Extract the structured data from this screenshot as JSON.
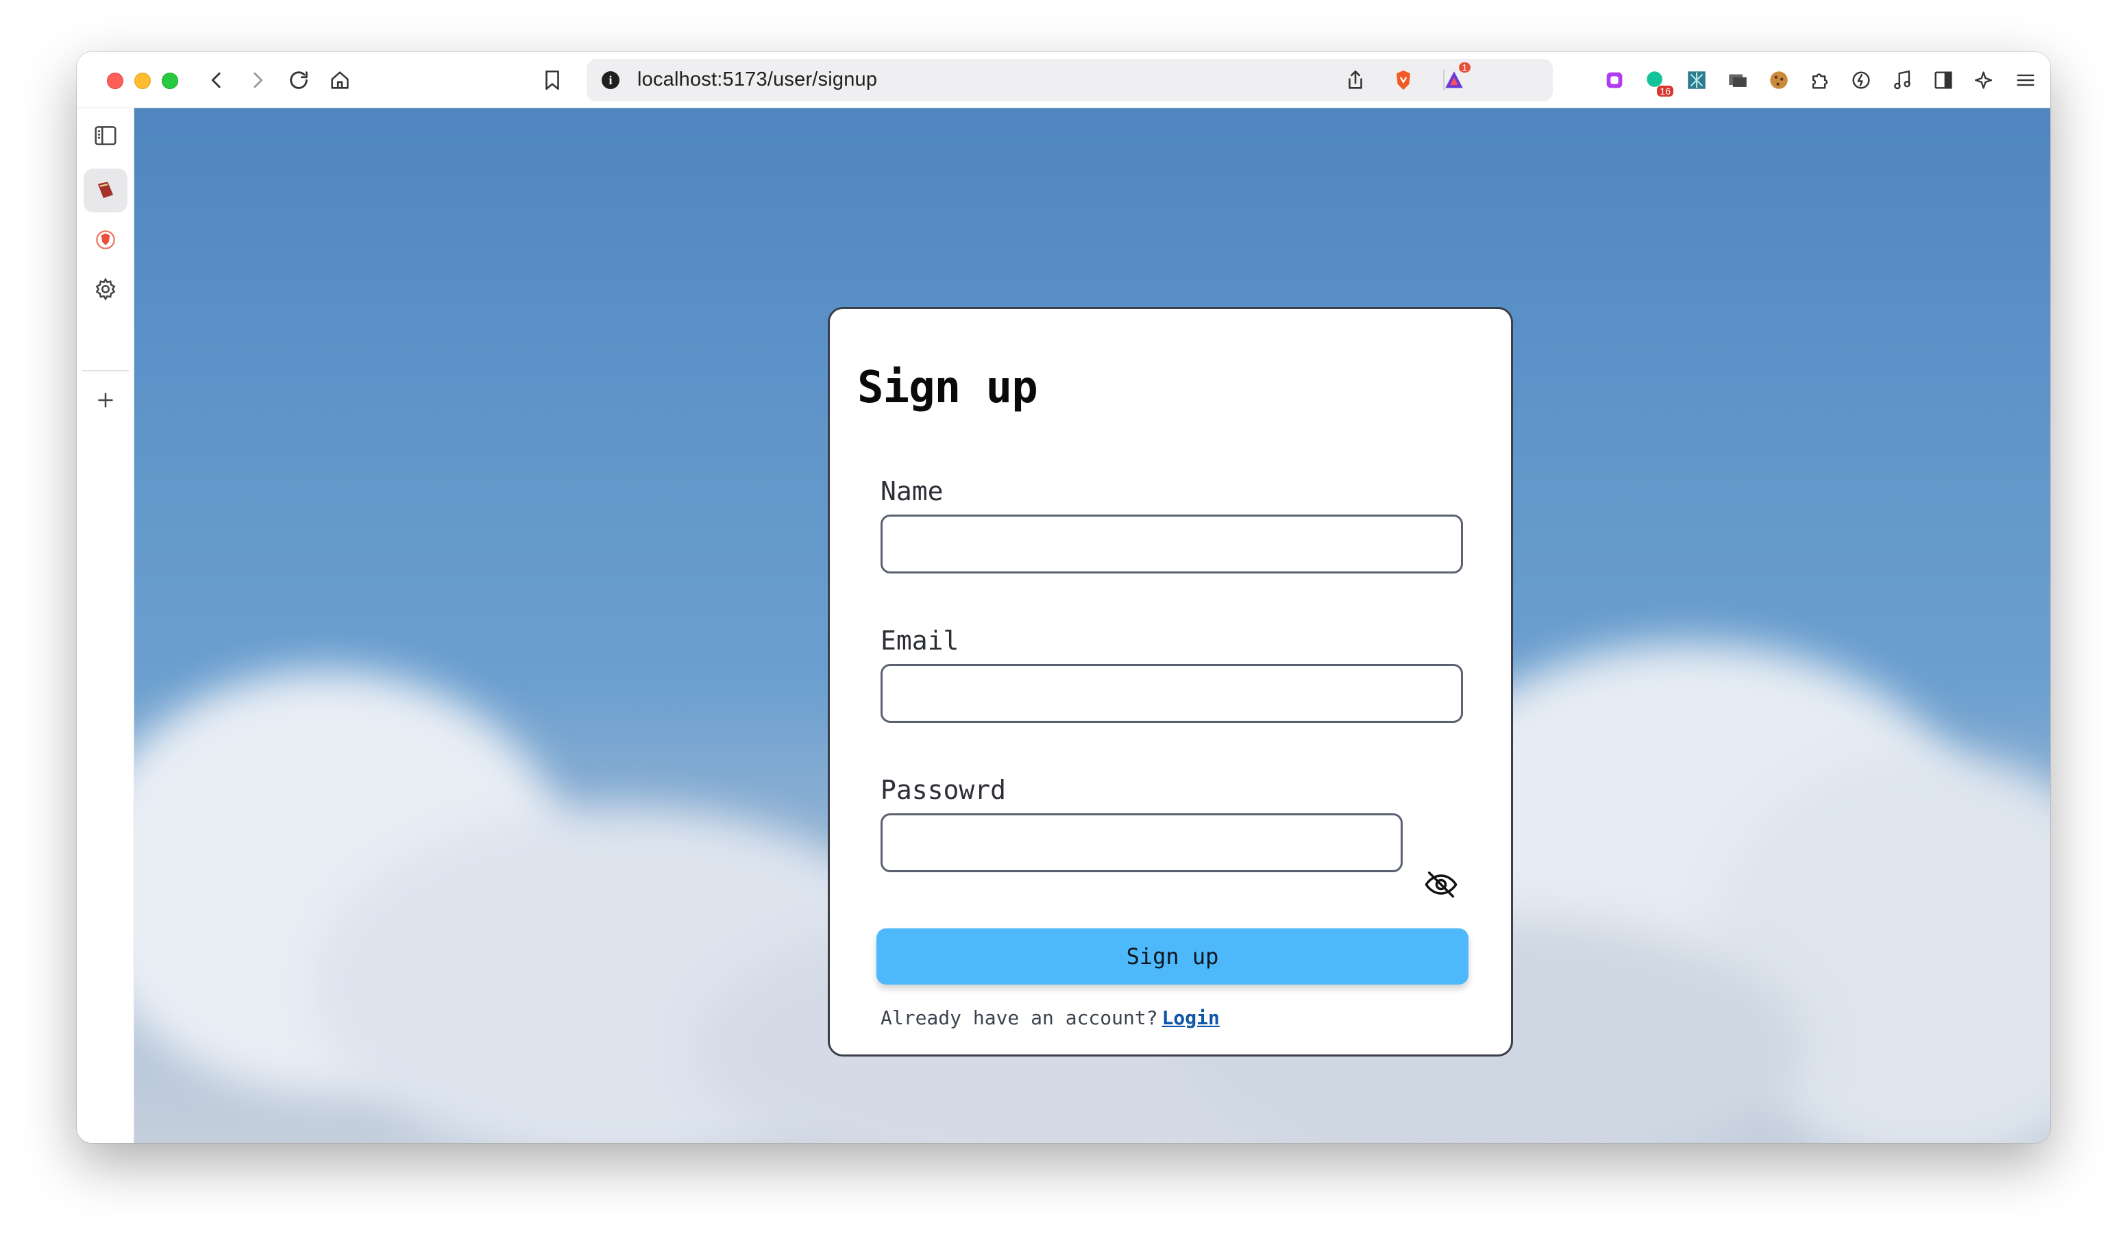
{
  "browser": {
    "url": "localhost:5173/user/signup",
    "extension_badge_count": "16",
    "rewards_badge_count": "1"
  },
  "form": {
    "title": "Sign up",
    "name_label": "Name",
    "name_value": "",
    "email_label": "Email",
    "email_value": "",
    "password_label": "Passowrd",
    "password_value": "",
    "submit_label": "Sign up",
    "footer_text": "Already have an account?",
    "login_link": "Login"
  },
  "colors": {
    "button": "#4db8fa",
    "link": "#0f56a8",
    "card_border": "#3a3f4b"
  }
}
